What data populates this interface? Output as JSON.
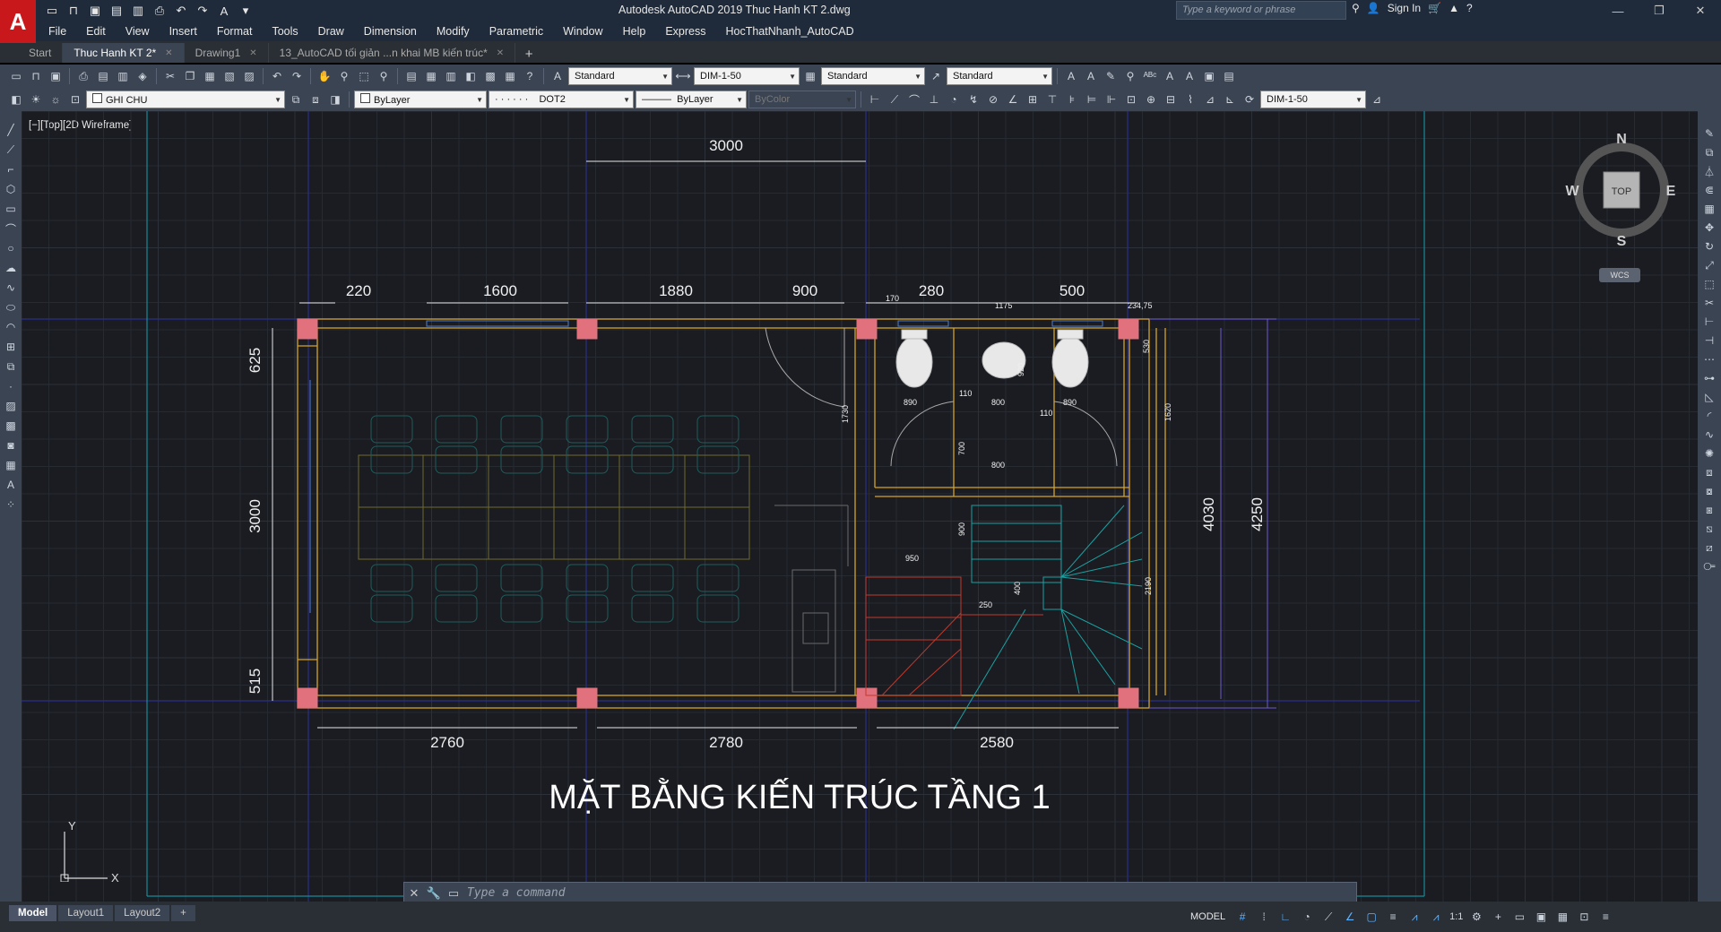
{
  "app": {
    "title": "Autodesk AutoCAD 2019    Thuc Hanh KT 2.dwg",
    "logo": "A",
    "search_placeholder": "Type a keyword or phrase",
    "sign_in": "Sign In"
  },
  "menu": [
    "File",
    "Edit",
    "View",
    "Insert",
    "Format",
    "Tools",
    "Draw",
    "Dimension",
    "Modify",
    "Parametric",
    "Window",
    "Help",
    "Express",
    "HocThatNhanh_AutoCAD"
  ],
  "tabs": [
    {
      "label": "Start",
      "active": false
    },
    {
      "label": "Thuc Hanh KT 2*",
      "active": true
    },
    {
      "label": "Drawing1",
      "active": false
    },
    {
      "label": "13_AutoCAD tối giản ...n khai MB kiến trúc*",
      "active": false
    }
  ],
  "toolbar1": {
    "text_style": "Standard",
    "dim_style": "DIM-1-50",
    "table_style": "Standard",
    "mleader_style": "Standard"
  },
  "toolbar2": {
    "layer": "GHI CHU",
    "color": "ByLayer",
    "linetype": "DOT2",
    "lineweight": "ByLayer",
    "plotstyle": "ByColor",
    "dim_style": "DIM-1-50"
  },
  "viewport": {
    "label": "[−][Top][2D Wireframe]"
  },
  "viewcube": {
    "n": "N",
    "s": "S",
    "e": "E",
    "w": "W",
    "face": "TOP",
    "wcs": "WCS"
  },
  "ucs": {
    "x": "X",
    "y": "Y"
  },
  "drawing": {
    "title": "MẶT BẰNG KIẾN TRÚC TẦNG 1",
    "dims_top_big": "3000",
    "dims_top": [
      "220",
      "1600",
      "1880",
      "900",
      "170",
      "280",
      "1175",
      "500",
      "234,75"
    ],
    "dims_bottom": [
      "2760",
      "2780",
      "2580"
    ],
    "dims_left": [
      "625",
      "3000",
      "515"
    ],
    "dims_right": [
      "4030",
      "4250"
    ],
    "dims_small": [
      "890",
      "110",
      "800",
      "890",
      "110",
      "920",
      "700",
      "800",
      "1620",
      "530",
      "1730",
      "900",
      "950",
      "250",
      "400",
      "2190"
    ]
  },
  "cmdline": {
    "placeholder": "Type a command"
  },
  "layouts": [
    "Model",
    "Layout1",
    "Layout2"
  ],
  "status": {
    "model": "MODEL",
    "scale": "1:1"
  }
}
